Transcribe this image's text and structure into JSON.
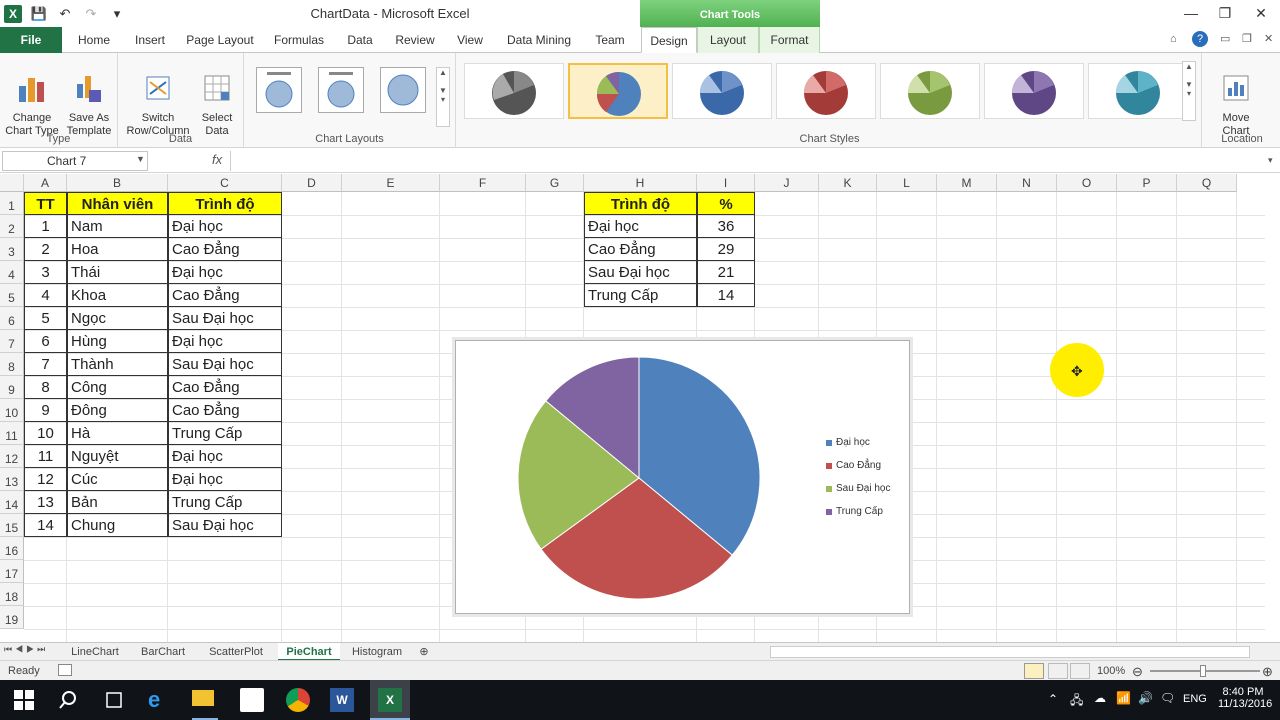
{
  "window": {
    "title": "ChartData  -  Microsoft Excel",
    "chart_tools": "Chart Tools"
  },
  "tabs": [
    "File",
    "Home",
    "Insert",
    "Page Layout",
    "Formulas",
    "Data",
    "Review",
    "View",
    "Data Mining",
    "Team",
    "Design",
    "Layout",
    "Format"
  ],
  "ribbon": {
    "type_group": {
      "label": "Type",
      "change_chart_type": "Change\nChart Type",
      "save_as_template": "Save As\nTemplate"
    },
    "data_group": {
      "label": "Data",
      "switch_row_column": "Switch\nRow/Column",
      "select_data": "Select\nData"
    },
    "layouts_label": "Chart Layouts",
    "styles_label": "Chart Styles",
    "location_group": {
      "label": "Location",
      "move_chart": "Move\nChart"
    }
  },
  "formula_bar": {
    "name_box": "Chart 7",
    "fx": "fx",
    "value": ""
  },
  "columns": [
    "A",
    "B",
    "C",
    "D",
    "E",
    "F",
    "G",
    "H",
    "I",
    "J",
    "K",
    "L",
    "M",
    "N",
    "O",
    "P",
    "Q"
  ],
  "rows": [
    "1",
    "2",
    "3",
    "4",
    "5",
    "6",
    "7",
    "8",
    "9",
    "10",
    "11",
    "12",
    "13",
    "14",
    "15",
    "16",
    "17",
    "18",
    "19"
  ],
  "employee_table": {
    "headers": [
      "TT",
      "Nhân viên",
      "Trình độ"
    ],
    "rows": [
      [
        "1",
        "Nam",
        "Đại học"
      ],
      [
        "2",
        "Hoa",
        "Cao Đẳng"
      ],
      [
        "3",
        "Thái",
        "Đại học"
      ],
      [
        "4",
        "Khoa",
        "Cao Đẳng"
      ],
      [
        "5",
        "Ngọc",
        "Sau Đại học"
      ],
      [
        "6",
        "Hùng",
        "Đại học"
      ],
      [
        "7",
        "Thành",
        "Sau Đại học"
      ],
      [
        "8",
        "Công",
        "Cao Đẳng"
      ],
      [
        "9",
        "Đông",
        "Cao Đẳng"
      ],
      [
        "10",
        "Hà",
        "Trung Cấp"
      ],
      [
        "11",
        "Nguyệt",
        "Đại học"
      ],
      [
        "12",
        "Cúc",
        "Đại học"
      ],
      [
        "13",
        "Bản",
        "Trung Cấp"
      ],
      [
        "14",
        "Chung",
        "Sau Đại học"
      ]
    ]
  },
  "summary_table": {
    "headers": [
      "Trình độ",
      "%"
    ],
    "rows": [
      [
        "Đại học",
        "36"
      ],
      [
        "Cao Đẳng",
        "29"
      ],
      [
        "Sau Đại học",
        "21"
      ],
      [
        "Trung Cấp",
        "14"
      ]
    ]
  },
  "chart_data": {
    "type": "pie",
    "categories": [
      "Đại học",
      "Cao Đẳng",
      "Sau Đại học",
      "Trung Cấp"
    ],
    "values": [
      36,
      29,
      21,
      14
    ],
    "colors": [
      "#4f81bd",
      "#c0504d",
      "#9bbb59",
      "#8064a2"
    ],
    "legend": "right"
  },
  "sheet_tabs": [
    "LineChart",
    "BarChart",
    "ScatterPlot",
    "PieChart",
    "Histogram"
  ],
  "active_sheet": "PieChart",
  "status": {
    "ready": "Ready",
    "zoom": "100%"
  },
  "tray": {
    "lang": "ENG",
    "time": "8:40 PM",
    "date": "11/13/2016"
  }
}
